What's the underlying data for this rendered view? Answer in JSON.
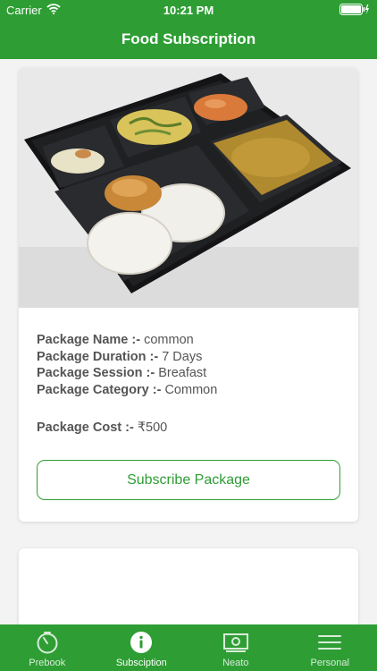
{
  "status_bar": {
    "carrier": "Carrier",
    "time": "10:21 PM"
  },
  "header": {
    "title": "Food Subscription"
  },
  "packages": [
    {
      "image": "food-tray-photo",
      "name_label": "Package Name :-",
      "name_value": " common",
      "duration_label": "Package Duration :-",
      "duration_value": " 7 Days",
      "session_label": "Package Session :-",
      "session_value": " Breafast",
      "category_label": "Package Category :-",
      "category_value": " Common",
      "cost_label": "Package Cost :-",
      "cost_value": " ₹500",
      "button_label": "Subscribe Package"
    }
  ],
  "tabbar": {
    "tabs": [
      {
        "label": "Prebook",
        "icon": "stopwatch-icon",
        "active": false
      },
      {
        "label": "Subsciption",
        "icon": "info-icon",
        "active": true
      },
      {
        "label": "Neato",
        "icon": "cash-icon",
        "active": false
      },
      {
        "label": "Personal",
        "icon": "menu-icon",
        "active": false
      }
    ]
  },
  "colors": {
    "primary": "#2e9e34",
    "background": "#f3f3f3",
    "card": "#ffffff",
    "text": "#555555"
  }
}
